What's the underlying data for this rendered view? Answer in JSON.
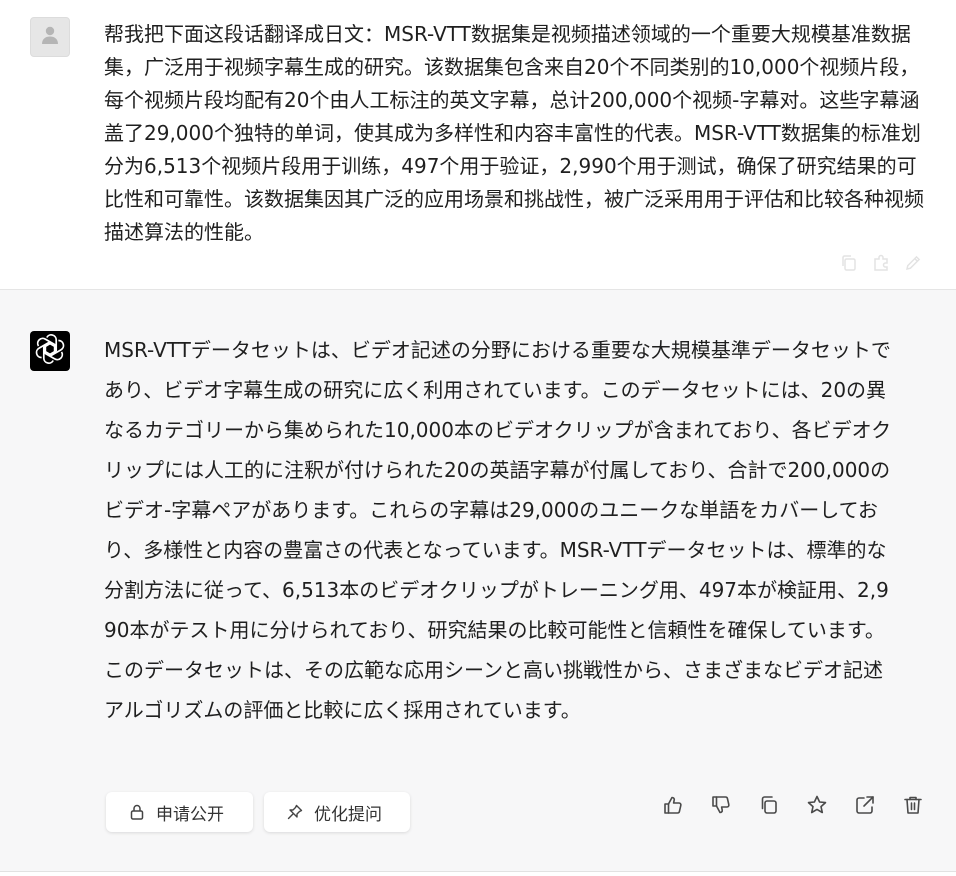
{
  "user_message": {
    "text": "帮我把下面这段话翻译成日文：MSR-VTT数据集是视频描述领域的一个重要大规模基准数据集，广泛用于视频字幕生成的研究。该数据集包含来自20个不同类别的10,000个视频片段，每个视频片段均配有20个由人工标注的英文字幕，总计200,000个视频-字幕对。这些字幕涵盖了29,000个独特的单词，使其成为多样性和内容丰富性的代表。MSR-VTT数据集的标准划分为6,513个视频片段用于训练，497个用于验证，2,990个用于测试，确保了研究结果的可比性和可靠性。该数据集因其广泛的应用场景和挑战性，被广泛采用用于评估和比较各种视频描述算法的性能。"
  },
  "assistant_message": {
    "text": "MSR-VTTデータセットは、ビデオ記述の分野における重要な大規模基準データセットであり、ビデオ字幕生成の研究に広く利用されています。このデータセットには、20の異なるカテゴリーから集められた10,000本のビデオクリップが含まれており、各ビデオクリップには人工的に注釈が付けられた20の英語字幕が付属しており、合計で200,000のビデオ-字幕ペアがあります。これらの字幕は29,000のユニークな単語をカバーしており、多様性と内容の豊富さの代表となっています。MSR-VTTデータセットは、標準的な分割方法に従って、6,513本のビデオクリップがトレーニング用、497本が検証用、2,990本がテスト用に分けられており、研究結果の比較可能性と信頼性を確保しています。このデータセットは、その広範な応用シーンと高い挑戦性から、さまざまなビデオ記述アルゴリズムの評価と比較に広く採用されています。"
  },
  "chips": {
    "apply_public": "申请公开",
    "optimize_question": "优化提问"
  },
  "icons": {
    "user_avatar": "user-silhouette-icon",
    "bot_avatar": "openai-logo-icon",
    "user_actions": [
      "copy-icon",
      "puzzle-icon",
      "edit-icon"
    ],
    "bot_actions": [
      "thumbs-up-icon",
      "thumbs-down-icon",
      "copy-icon",
      "star-icon",
      "share-icon",
      "trash-icon"
    ],
    "chip_public": "lock-icon",
    "chip_optimize": "pin-icon"
  },
  "colors": {
    "assistant_background": "#f7f7f8",
    "user_background": "#ffffff",
    "bot_avatar_background": "#000000",
    "text": "#1f1f1f"
  }
}
